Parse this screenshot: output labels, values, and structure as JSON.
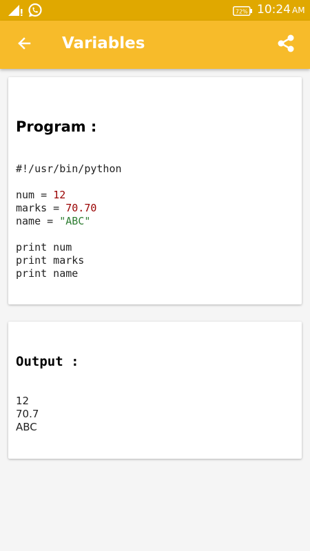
{
  "status_bar": {
    "battery_percent": "72%",
    "time": "10:24",
    "time_suffix": "AM",
    "icons": [
      "signal-icon",
      "whatsapp-icon",
      "battery-icon"
    ]
  },
  "app_bar": {
    "title": "Variables",
    "back_icon": "arrow-left-icon",
    "share_icon": "share-icon",
    "background_color": "#f7bb2a",
    "status_color": "#e0a800"
  },
  "program": {
    "heading": "Program :",
    "lines": [
      {
        "text": "#!/usr/bin/python"
      },
      {
        "text": ""
      },
      {
        "prefix": "num = ",
        "value": "12",
        "value_type": "number"
      },
      {
        "prefix": "marks = ",
        "value": "70.70",
        "value_type": "number"
      },
      {
        "prefix": "name = ",
        "value": "\"ABC\"",
        "value_type": "string"
      },
      {
        "text": ""
      },
      {
        "text": "print num"
      },
      {
        "text": "print marks"
      },
      {
        "text": "print name"
      }
    ]
  },
  "output": {
    "heading": "Output :",
    "lines": [
      "12",
      "70.7",
      "ABC"
    ]
  }
}
